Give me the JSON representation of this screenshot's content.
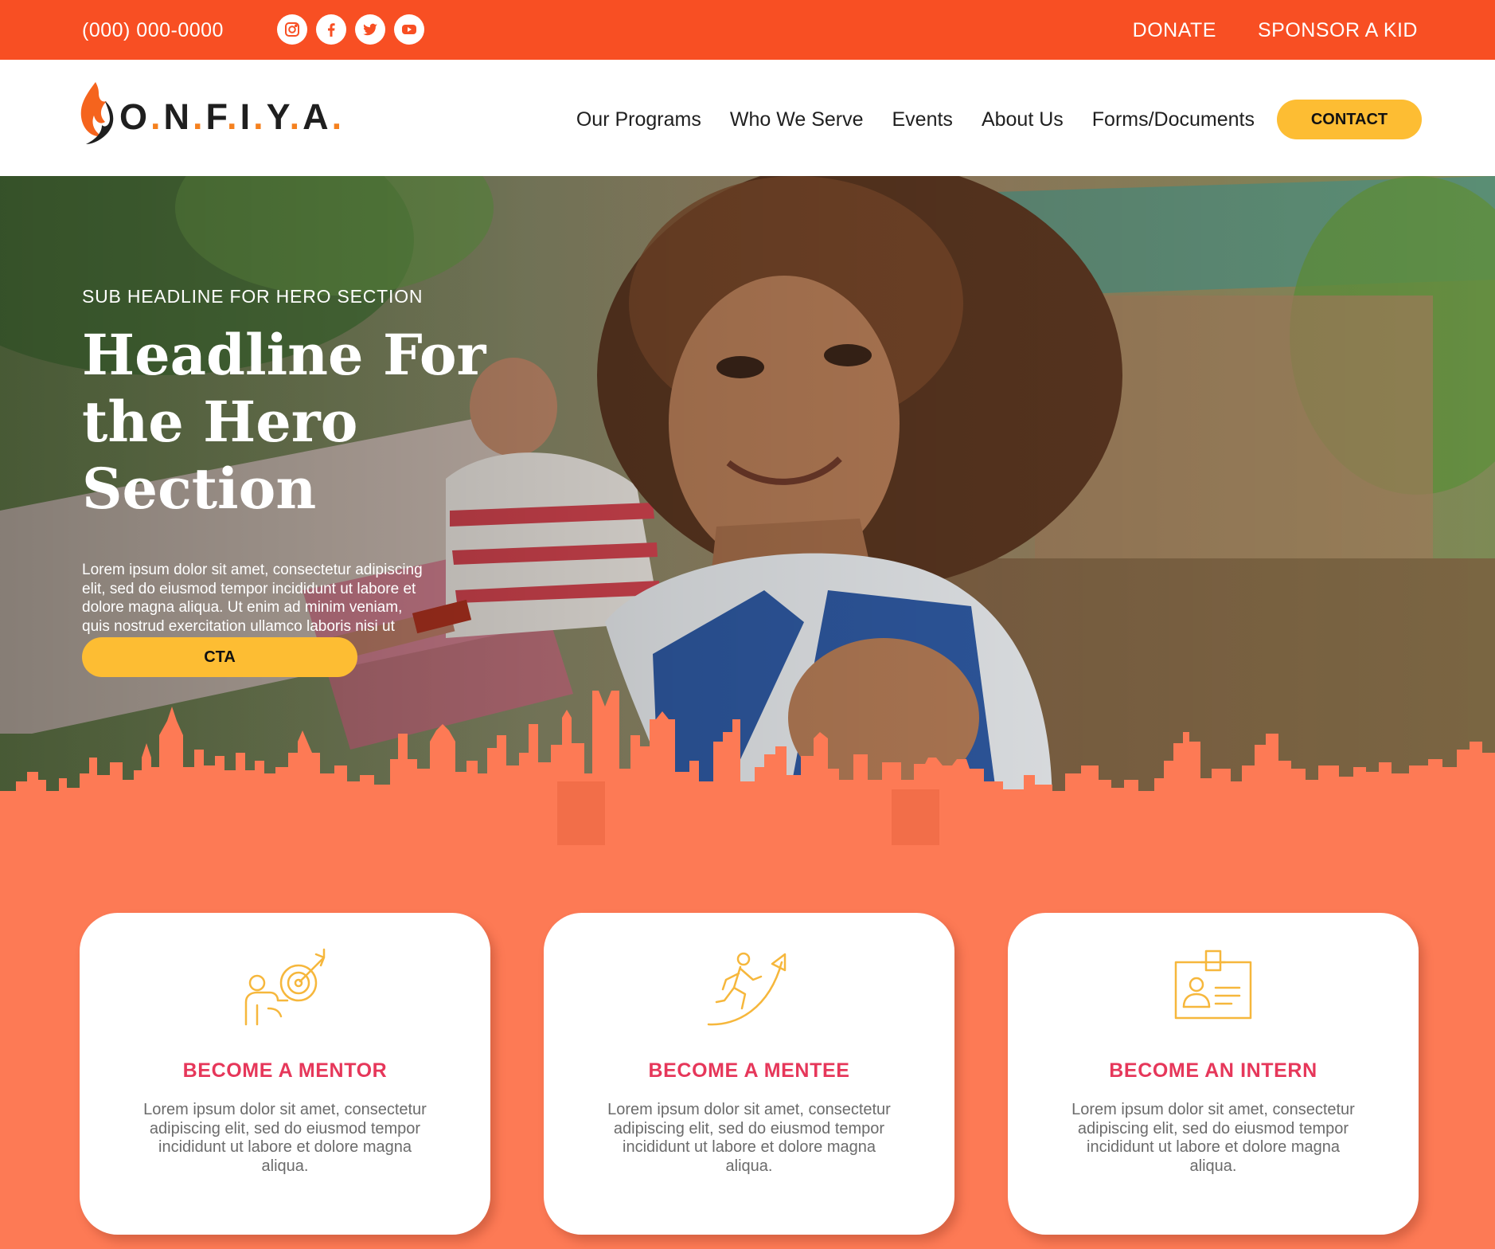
{
  "topbar": {
    "phone": "(000) 000-0000",
    "socials": [
      {
        "name": "instagram-icon"
      },
      {
        "name": "facebook-icon"
      },
      {
        "name": "twitter-icon"
      },
      {
        "name": "youtube-icon"
      }
    ],
    "links": [
      "DONATE",
      "SPONSOR A KID"
    ]
  },
  "nav": {
    "logo_text": "ONFIYA",
    "items": [
      "Our Programs",
      "Who We Serve",
      "Events",
      "About Us",
      "Forms/Documents"
    ],
    "contact_label": "CONTACT"
  },
  "hero": {
    "sub_headline": "SUB HEADLINE FOR HERO SECTION",
    "headline": "Headline For the Hero Section",
    "body": "Lorem ipsum dolor sit amet, consectetur adipiscing elit, sed do eiusmod tempor incididunt ut labore et dolore magna aliqua. Ut enim ad minim veniam, quis nostrud exercitation ullamco laboris nisi ut",
    "cta_label": "CTA"
  },
  "cards": [
    {
      "icon": "mentor-target-icon",
      "title": "BECOME A MENTOR",
      "text": "Lorem ipsum dolor sit amet, consectetur adipiscing elit, sed do eiusmod tempor incididunt ut labore et dolore magna aliqua."
    },
    {
      "icon": "mentee-growth-icon",
      "title": "BECOME A MENTEE",
      "text": "Lorem ipsum dolor sit amet, consectetur adipiscing elit, sed do eiusmod tempor incididunt ut labore et dolore magna aliqua."
    },
    {
      "icon": "intern-badge-icon",
      "title": "BECOME AN INTERN",
      "text": "Lorem ipsum dolor sit amet, consectetur adipiscing elit, sed do eiusmod tempor incididunt ut labore et dolore magna aliqua."
    }
  ],
  "colors": {
    "topbar": "#f84f23",
    "accent_yellow": "#fdbd33",
    "section_bg": "#fd7a55",
    "card_title": "#e6375a",
    "icon_stroke": "#f6b73c"
  }
}
